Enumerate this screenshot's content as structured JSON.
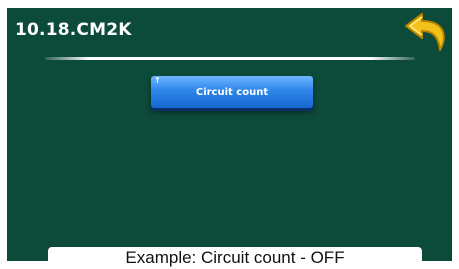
{
  "header": {
    "title": "10.18.CM2K",
    "back_icon": "back-arrow-icon"
  },
  "main": {
    "circuit_button_label": "Circuit count",
    "circuit_button_mark": "↑"
  },
  "caption": {
    "text": "Example: Circuit count - OFF"
  },
  "colors": {
    "background": "#0c4a3a",
    "button": "#2f86ea",
    "back_arrow": "#f2c21b"
  }
}
